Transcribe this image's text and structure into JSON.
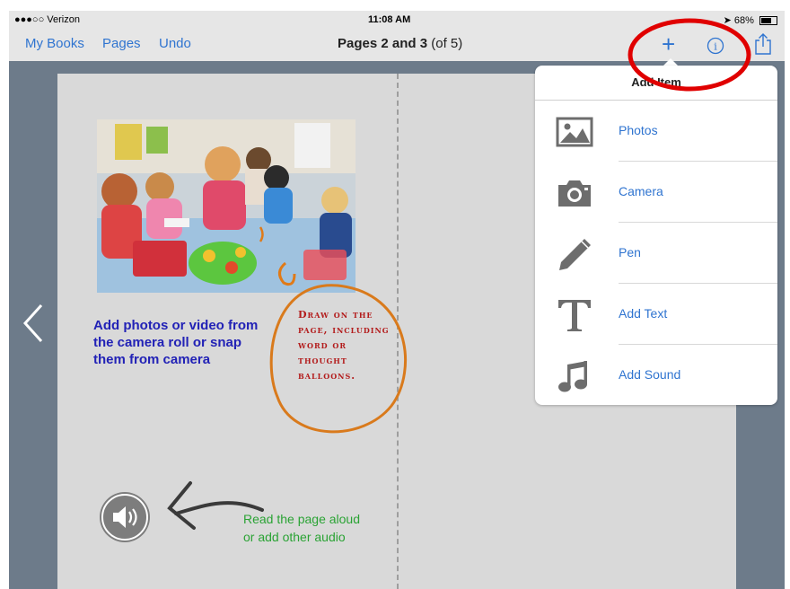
{
  "status_bar": {
    "carrier": "●●●○○ Verizon",
    "time": "11:08 AM",
    "battery": "68%"
  },
  "navbar": {
    "my_books": "My Books",
    "pages": "Pages",
    "undo": "Undo",
    "title": "Pages 2 and 3",
    "title_suffix": "(of 5)"
  },
  "page": {
    "photo_caption": "Add photos or video from the camera roll or snap them from camera",
    "drawn_note": "Draw on the page, including word or thought balloons.",
    "audio_note_line1": "Read the page aloud",
    "audio_note_line2": "or add other audio"
  },
  "add_menu": {
    "title": "Add Item",
    "items": [
      {
        "label": "Photos",
        "icon": "photo-icon"
      },
      {
        "label": "Camera",
        "icon": "camera-icon"
      },
      {
        "label": "Pen",
        "icon": "pen-icon"
      },
      {
        "label": "Add Text",
        "icon": "text-icon"
      },
      {
        "label": "Add Sound",
        "icon": "music-note-icon"
      }
    ]
  },
  "colors": {
    "ios_blue": "#2f74d0",
    "caption_blue": "#2222b6",
    "drawn_red": "#b31c1c",
    "drawn_orange": "#d97a1c",
    "audio_green": "#2aa334",
    "highlight_red": "#e00000"
  }
}
